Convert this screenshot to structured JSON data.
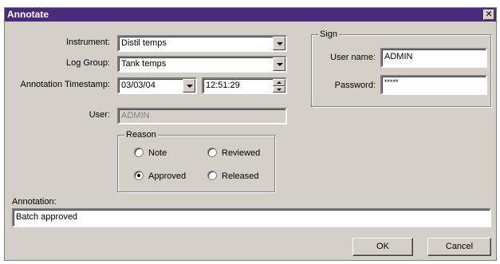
{
  "window": {
    "title": "Annotate",
    "close_glyph": "✕"
  },
  "form": {
    "instrument": {
      "label": "Instrument:",
      "value": "Distil temps"
    },
    "log_group": {
      "label": "Log Group:",
      "value": "Tank temps"
    },
    "timestamp": {
      "label": "Annotation Timestamp:",
      "date": "03/03/04",
      "time": "12:51:29"
    },
    "user": {
      "label": "User:",
      "value": "ADMIN"
    }
  },
  "reason": {
    "title": "Reason",
    "options": [
      {
        "label": "Note",
        "checked": false
      },
      {
        "label": "Reviewed",
        "checked": false
      },
      {
        "label": "Approved",
        "checked": true
      },
      {
        "label": "Released",
        "checked": false
      }
    ]
  },
  "sign": {
    "title": "Sign",
    "user_name": {
      "label": "User name:",
      "value": "ADMIN"
    },
    "password": {
      "label": "Password:",
      "value": "*****"
    }
  },
  "annotation": {
    "label": "Annotation:",
    "value": "Batch approved"
  },
  "buttons": {
    "ok": "OK",
    "cancel": "Cancel"
  },
  "colors": {
    "titlebar": "#4a2a7a",
    "dialog_bg": "#d4d0c8"
  }
}
